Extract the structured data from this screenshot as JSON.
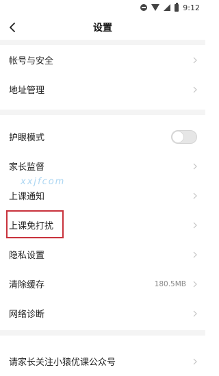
{
  "status_bar": {
    "time": "9:12"
  },
  "header": {
    "title": "设置",
    "back_icon": "chevron-left-icon"
  },
  "group1": [
    {
      "label": "帐号与安全"
    },
    {
      "label": "地址管理"
    }
  ],
  "group2": [
    {
      "label": "护眼模式",
      "control": "toggle",
      "toggle_on": false
    },
    {
      "label": "家长监督"
    },
    {
      "label": "上课通知"
    },
    {
      "label": "上课免打扰",
      "highlighted": true
    },
    {
      "label": "隐私设置"
    },
    {
      "label": "清除缓存",
      "value": "180.5MB"
    },
    {
      "label": "网络诊断"
    }
  ],
  "group3": [
    {
      "label": "请家长关注小猿优课公众号"
    }
  ],
  "watermark": "xxjfcom",
  "colors": {
    "highlight": "#c8323c",
    "divider": "#f4f4f4",
    "text": "#222222",
    "muted": "#888888"
  }
}
